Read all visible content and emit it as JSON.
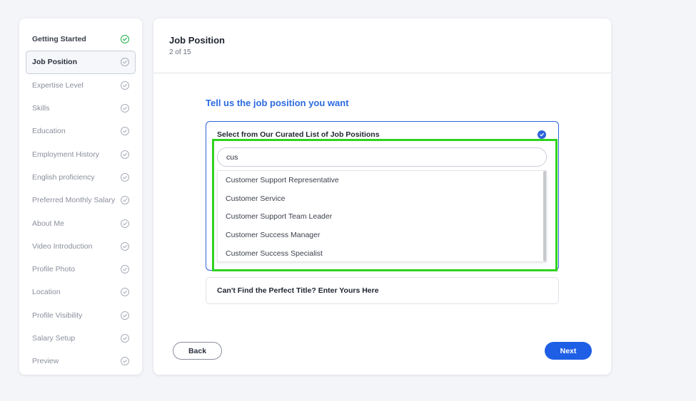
{
  "sidebar": {
    "items": [
      {
        "label": "Getting Started",
        "state": "done",
        "icon": "check-circle-icon"
      },
      {
        "label": "Job Position",
        "state": "active",
        "icon": "check-circle-icon"
      },
      {
        "label": "Expertise Level",
        "state": "pending",
        "icon": "check-circle-icon"
      },
      {
        "label": "Skills",
        "state": "pending",
        "icon": "check-circle-icon"
      },
      {
        "label": "Education",
        "state": "pending",
        "icon": "check-circle-icon"
      },
      {
        "label": "Employment History",
        "state": "pending",
        "icon": "check-circle-icon"
      },
      {
        "label": "English proficiency",
        "state": "pending",
        "icon": "check-circle-icon"
      },
      {
        "label": "Preferred Monthly Salary",
        "state": "pending",
        "icon": "check-circle-icon"
      },
      {
        "label": "About Me",
        "state": "pending",
        "icon": "check-circle-icon"
      },
      {
        "label": "Video Introduction",
        "state": "pending",
        "icon": "check-circle-icon"
      },
      {
        "label": "Profile Photo",
        "state": "pending",
        "icon": "check-circle-icon"
      },
      {
        "label": "Location",
        "state": "pending",
        "icon": "check-circle-icon"
      },
      {
        "label": "Profile Visibility",
        "state": "pending",
        "icon": "check-circle-icon"
      },
      {
        "label": "Salary Setup",
        "state": "pending",
        "icon": "check-circle-icon"
      },
      {
        "label": "Preview",
        "state": "pending",
        "icon": "check-circle-icon"
      }
    ]
  },
  "main": {
    "title": "Job Position",
    "step": "2 of 15",
    "question": "Tell us the job position you want",
    "curated": {
      "title": "Select from Our Curated List of Job Positions",
      "search_value": "cus",
      "options": [
        "Customer Support Representative",
        "Customer Service",
        "Customer Support Team Leader",
        "Customer Success Manager",
        "Customer Success Specialist"
      ]
    },
    "custom_label": "Can't Find the Perfect Title? Enter Yours Here",
    "back_label": "Back",
    "next_label": "Next"
  },
  "colors": {
    "accent": "#1f5fe6",
    "question": "#2c6be0",
    "done_check": "#22b24c",
    "highlight": "#2ed31f"
  }
}
